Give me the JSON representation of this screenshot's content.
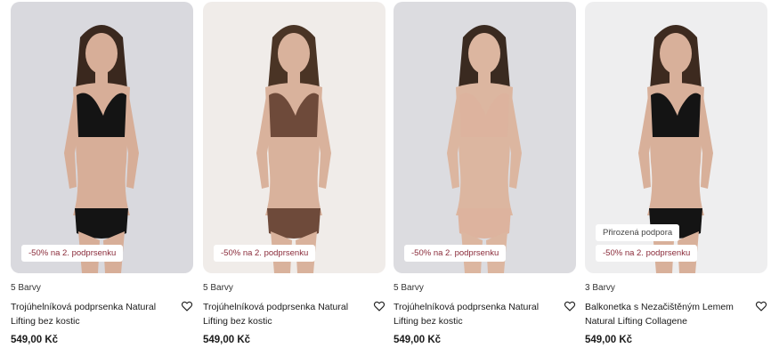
{
  "products": [
    {
      "colors": "5 Barvy",
      "title": "Trojúhelníková podprsenka Natural Lifting bez kostic",
      "price": "549,00 Kč",
      "badges": [
        "-50% na 2. podprsenku"
      ],
      "image": {
        "background": "#d9d9de",
        "bra_color": "#141414",
        "skin": "#d7ae98",
        "hair": "#3a281e"
      }
    },
    {
      "colors": "5 Barvy",
      "title": "Trojúhelníková podprsenka Natural Lifting bez kostic",
      "price": "549,00 Kč",
      "badges": [
        "-50% na 2. podprsenku"
      ],
      "image": {
        "background": "#f0ece9",
        "bra_color": "#6e4a3a",
        "skin": "#d9b29c",
        "hair": "#4a3425"
      }
    },
    {
      "colors": "5 Barvy",
      "title": "Trojúhelníková podprsenka Natural Lifting bez kostic",
      "price": "549,00 Kč",
      "badges": [
        "-50% na 2. podprsenku"
      ],
      "image": {
        "background": "#dcdce0",
        "bra_color": "#ddb39e",
        "skin": "#dcb6a0",
        "hair": "#3a2a20"
      }
    },
    {
      "colors": "3 Barvy",
      "title": "Balkonetka s Nezačištěným Lemem Natural Lifting Collagene",
      "price": "549,00 Kč",
      "badges": [
        "Přirozená podpora",
        "-50% na 2. podprsenku"
      ],
      "image": {
        "background": "#eeeeef",
        "bra_color": "#141414",
        "skin": "#d8b09a",
        "hair": "#3d2a1f"
      }
    }
  ]
}
